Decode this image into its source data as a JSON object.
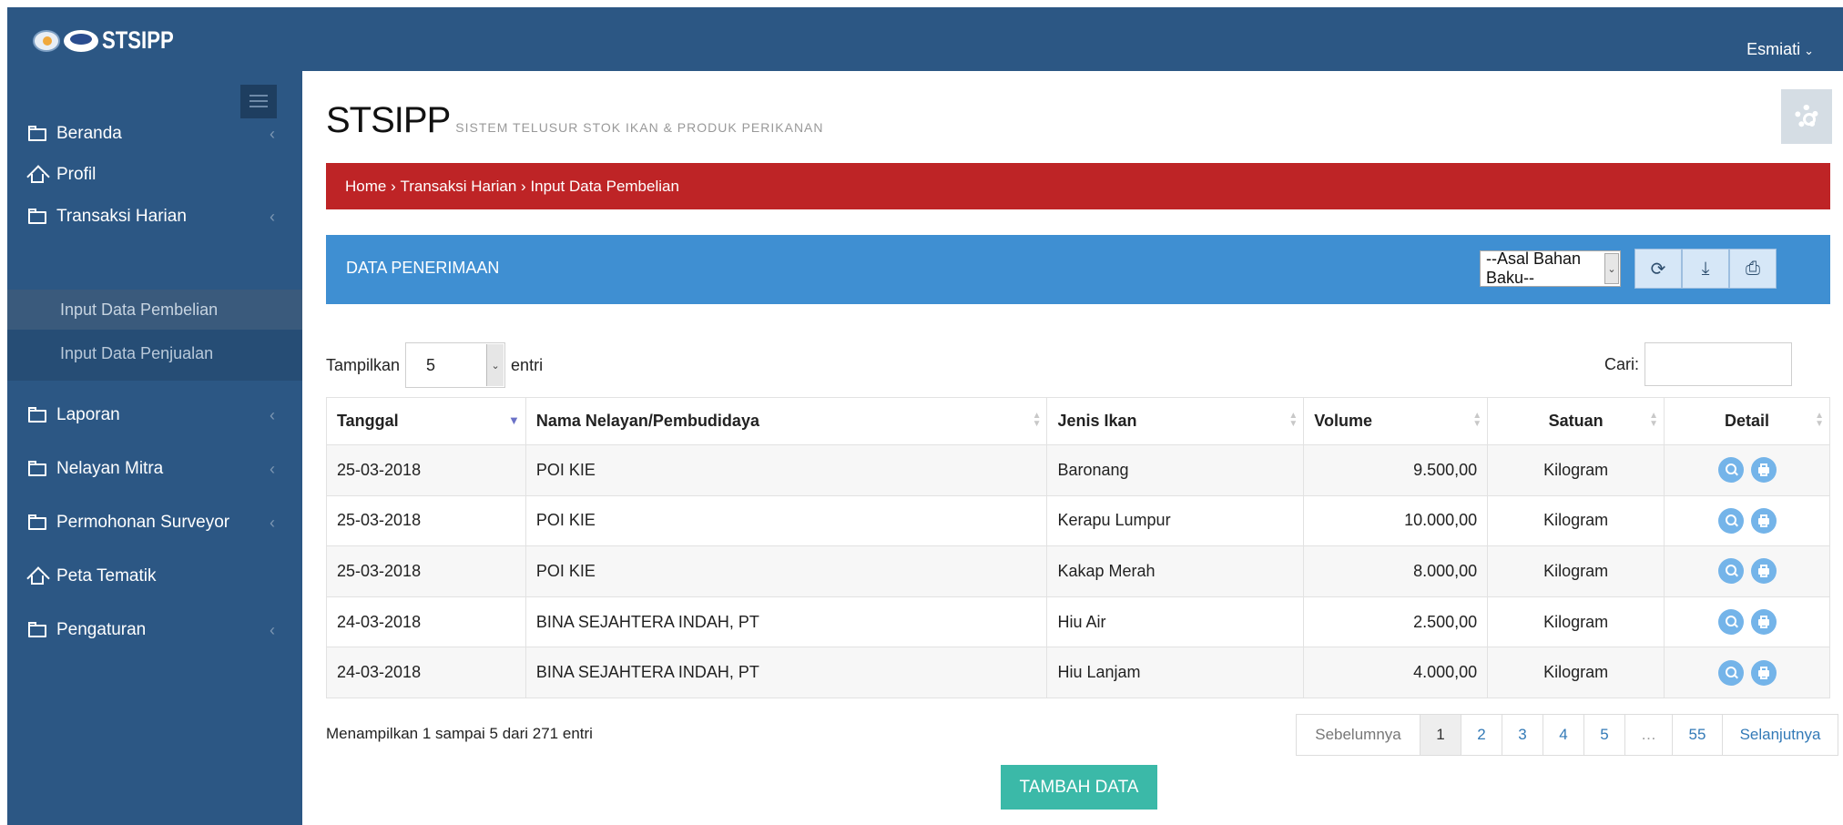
{
  "app": {
    "name": "STSIPP",
    "subtitle": "SISTEM TELUSUR STOK IKAN & PRODUK PERIKANAN"
  },
  "header": {
    "user": "Esmiati"
  },
  "sidebar": {
    "items": [
      {
        "label": "Beranda",
        "icon": "folder-icon"
      },
      {
        "label": "Profil",
        "icon": "home-icon"
      },
      {
        "label": "Transaksi Harian",
        "icon": "folder-icon"
      },
      {
        "label": "Laporan",
        "icon": "folder-icon"
      },
      {
        "label": "Nelayan Mitra",
        "icon": "folder-icon"
      },
      {
        "label": "Permohonan Surveyor",
        "icon": "folder-icon"
      },
      {
        "label": "Peta Tematik",
        "icon": "home-icon"
      },
      {
        "label": "Pengaturan",
        "icon": "folder-icon"
      }
    ],
    "sub_items": [
      "Input Data Pembelian",
      "Input Data Penjualan"
    ]
  },
  "breadcrumb": {
    "home": "Home",
    "level1": "Transaksi Harian",
    "level2": "Input Data Pembelian"
  },
  "panel": {
    "title": "DATA PENERIMAAN",
    "source_select": "--Asal Bahan Baku--"
  },
  "length": {
    "prefix": "Tampilkan",
    "value": "5",
    "suffix": "entri"
  },
  "search": {
    "label": "Cari:"
  },
  "table": {
    "headers": [
      "Tanggal",
      "Nama Nelayan/Pembudidaya",
      "Jenis Ikan",
      "Volume",
      "Satuan",
      "Detail"
    ],
    "rows": [
      [
        "25-03-2018",
        "POI KIE",
        "Baronang",
        "9.500,00",
        "Kilogram"
      ],
      [
        "25-03-2018",
        "POI KIE",
        "Kerapu Lumpur",
        "10.000,00",
        "Kilogram"
      ],
      [
        "25-03-2018",
        "POI KIE",
        "Kakap Merah",
        "8.000,00",
        "Kilogram"
      ],
      [
        "24-03-2018",
        "BINA SEJAHTERA INDAH, PT",
        "Hiu Air",
        "2.500,00",
        "Kilogram"
      ],
      [
        "24-03-2018",
        "BINA SEJAHTERA INDAH, PT",
        "Hiu Lanjam",
        "4.000,00",
        "Kilogram"
      ]
    ]
  },
  "info": "Menampilkan 1 sampai 5 dari 271 entri",
  "pagination": {
    "prev": "Sebelumnya",
    "pages": [
      "1",
      "2",
      "3",
      "4",
      "5",
      "…",
      "55"
    ],
    "next": "Selanjutnya",
    "current": "1"
  },
  "add_button": "TAMBAH DATA",
  "colors": {
    "header": "#2c5784",
    "breadcrumb": "#be2426",
    "panel": "#3f8fd2",
    "add_button": "#3bb9a8"
  }
}
